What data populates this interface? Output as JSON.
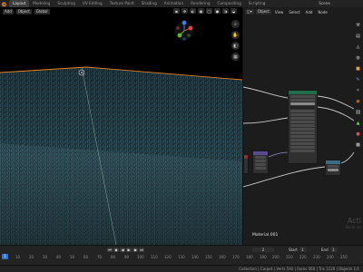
{
  "topbar": {
    "tabs": [
      "Layout",
      "Modeling",
      "Sculpting",
      "UV Editing",
      "Texture Paint",
      "Shading",
      "Animation",
      "Rendering",
      "Compositing",
      "Scripting"
    ],
    "active_tab": "Layout",
    "scene": "Scene"
  },
  "viewport": {
    "header": {
      "add": "Add",
      "object": "Object",
      "transform": "Global"
    },
    "gizmo_colors": {
      "x": "#e0443d",
      "y": "#6ab03a",
      "z": "#3f7be0"
    },
    "selection_color": "#e2821d"
  },
  "node_editor": {
    "header": {
      "mode": "Object",
      "menus": [
        "View",
        "Select",
        "Add",
        "Node"
      ]
    },
    "material_label": "Material.001",
    "watermark": "Acti",
    "watermark_sub": "Go to Se"
  },
  "timeline": {
    "current_frame": "2",
    "start_label": "Start",
    "start_value": "1",
    "end_label": "End",
    "end_value": "1",
    "ticks": [
      "0",
      "10",
      "20",
      "30",
      "40",
      "50",
      "60",
      "70",
      "80",
      "90",
      "100",
      "110",
      "120",
      "130",
      "140",
      "150",
      "160",
      "170",
      "180",
      "190",
      "200",
      "210",
      "220",
      "230",
      "240",
      "250"
    ],
    "playhead_value": "1"
  },
  "statusbar": {
    "text": "Collection | Carpet | Verts 592 | Faces 560 | Tris 1120 | Objects 1/1"
  }
}
